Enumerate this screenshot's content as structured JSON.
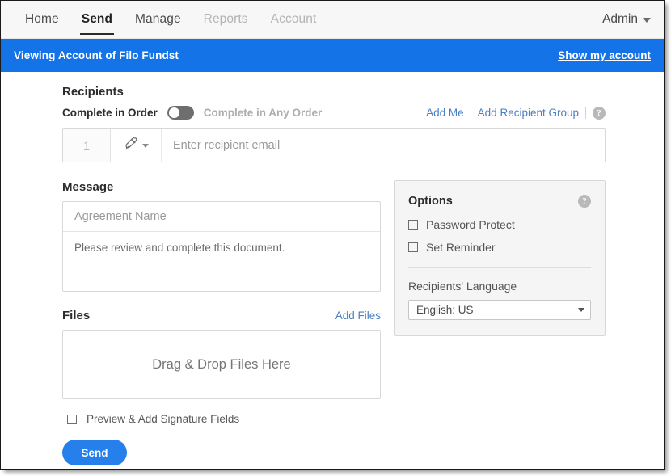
{
  "topnav": {
    "items": [
      {
        "label": "Home",
        "state": "normal"
      },
      {
        "label": "Send",
        "state": "active"
      },
      {
        "label": "Manage",
        "state": "normal"
      },
      {
        "label": "Reports",
        "state": "dim"
      },
      {
        "label": "Account",
        "state": "dim"
      }
    ],
    "admin_label": "Admin"
  },
  "banner": {
    "prefix": "Viewing Account of",
    "account_name": "Filo Fundst",
    "link_label": "Show my account",
    "background_color": "#1473e6"
  },
  "recipients": {
    "title": "Recipients",
    "order_on_label": "Complete in Order",
    "order_off_label": "Complete in Any Order",
    "toggle_state": "Complete in Order",
    "add_me_label": "Add Me",
    "add_group_label": "Add Recipient Group",
    "help_glyph": "?",
    "row": {
      "number": "1",
      "role_icon": "signature-pen-icon",
      "email_placeholder": "Enter recipient email",
      "email_value": ""
    }
  },
  "message": {
    "title": "Message",
    "agreement_name_placeholder": "Agreement Name",
    "agreement_name_value": "",
    "body_value": "Please review and complete this document."
  },
  "files": {
    "title": "Files",
    "add_files_label": "Add Files",
    "dropzone_label": "Drag & Drop Files Here"
  },
  "options": {
    "title": "Options",
    "help_glyph": "?",
    "checkboxes": [
      {
        "label": "Password Protect",
        "checked": false
      },
      {
        "label": "Set Reminder",
        "checked": false
      }
    ],
    "language_label": "Recipients' Language",
    "language_value": "English: US",
    "language_options": [
      "English: US"
    ]
  },
  "footer": {
    "preview_label": "Preview & Add Signature Fields",
    "preview_checked": false,
    "send_label": "Send",
    "send_color": "#2680eb"
  }
}
